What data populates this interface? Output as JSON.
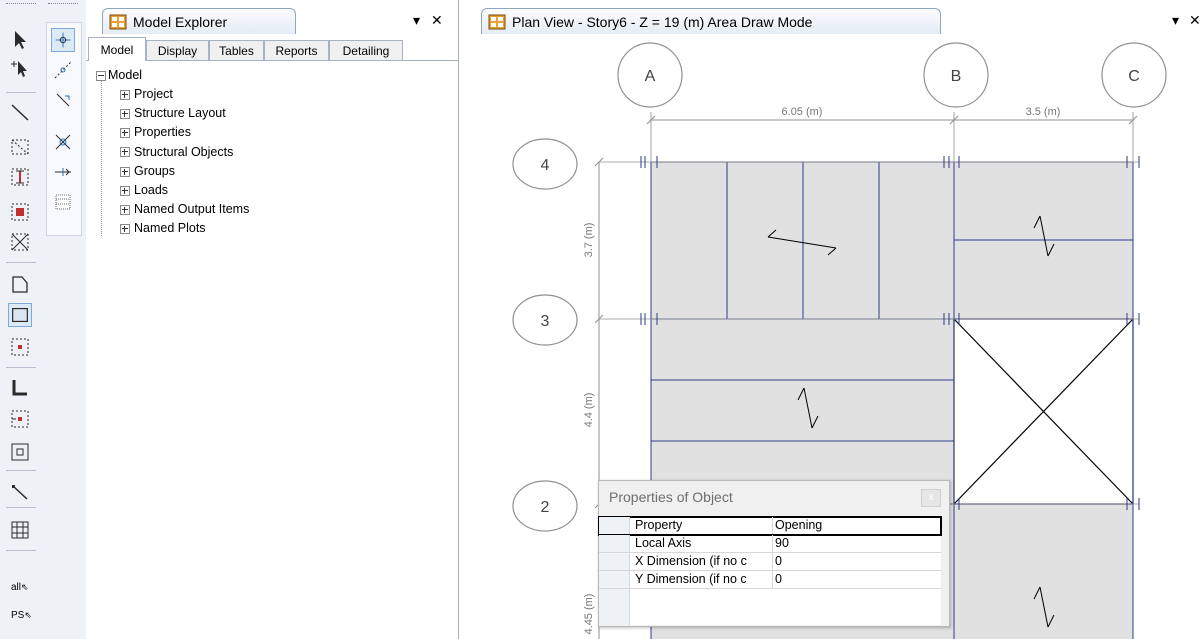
{
  "toolbar": {
    "left_column": [
      "select-pointer-icon",
      "pan-pointer-icon",
      "draw-line-icon",
      "select-rectangle-icon",
      "select-column-icon",
      "select-beam-icon",
      "select-cross-icon",
      "draw-polygon-icon",
      "draw-rectangle-area-icon",
      "draw-point-area-icon",
      "draw-wall-icon",
      "draw-wall-point-icon",
      "draw-opening-icon",
      "draw-brace-icon",
      "grid-icon"
    ],
    "right_column": [
      "snap-point-icon",
      "snap-line-icon",
      "snap-intersection-icon",
      "snap-perpendicular-icon",
      "snap-midpoint-icon",
      "snap-grid-icon"
    ],
    "select_all_label": "all",
    "select_ps_label": "PS"
  },
  "explorer": {
    "title": "Model Explorer",
    "pin": "▾",
    "close": "✕",
    "tabs": [
      "Model",
      "Display",
      "Tables",
      "Reports",
      "Detailing"
    ],
    "active_tab": "Model",
    "tree_root": "Model",
    "tree_items": [
      "Project",
      "Structure Layout",
      "Properties",
      "Structural Objects",
      "Groups",
      "Loads",
      "Named Output Items",
      "Named Plots"
    ]
  },
  "plan_view": {
    "title": "Plan View - Story6 - Z = 19 (m)  Area Draw Mode",
    "pin": "▾",
    "close": "✕",
    "grid_x": [
      {
        "label": "A"
      },
      {
        "label": "B"
      },
      {
        "label": "C"
      }
    ],
    "grid_y": [
      {
        "label": "4"
      },
      {
        "label": "3"
      },
      {
        "label": "2"
      }
    ],
    "dims_x": [
      "6.05 (m)",
      "3.5 (m)"
    ],
    "dims_y": [
      "3.7 (m)",
      "4.4 (m)",
      "4.45 (m)"
    ],
    "colors": {
      "slab": "#e1e1e1",
      "line": "#2e3a8c",
      "bubble": "#909090"
    }
  },
  "properties_dialog": {
    "title": "Properties of Object",
    "close": "x",
    "rows": [
      {
        "name": "Property",
        "value": "Opening"
      },
      {
        "name": "Local Axis",
        "value": "90"
      },
      {
        "name": "X Dimension (if no c",
        "value": "0"
      },
      {
        "name": "Y Dimension (if no c",
        "value": "0"
      }
    ]
  }
}
